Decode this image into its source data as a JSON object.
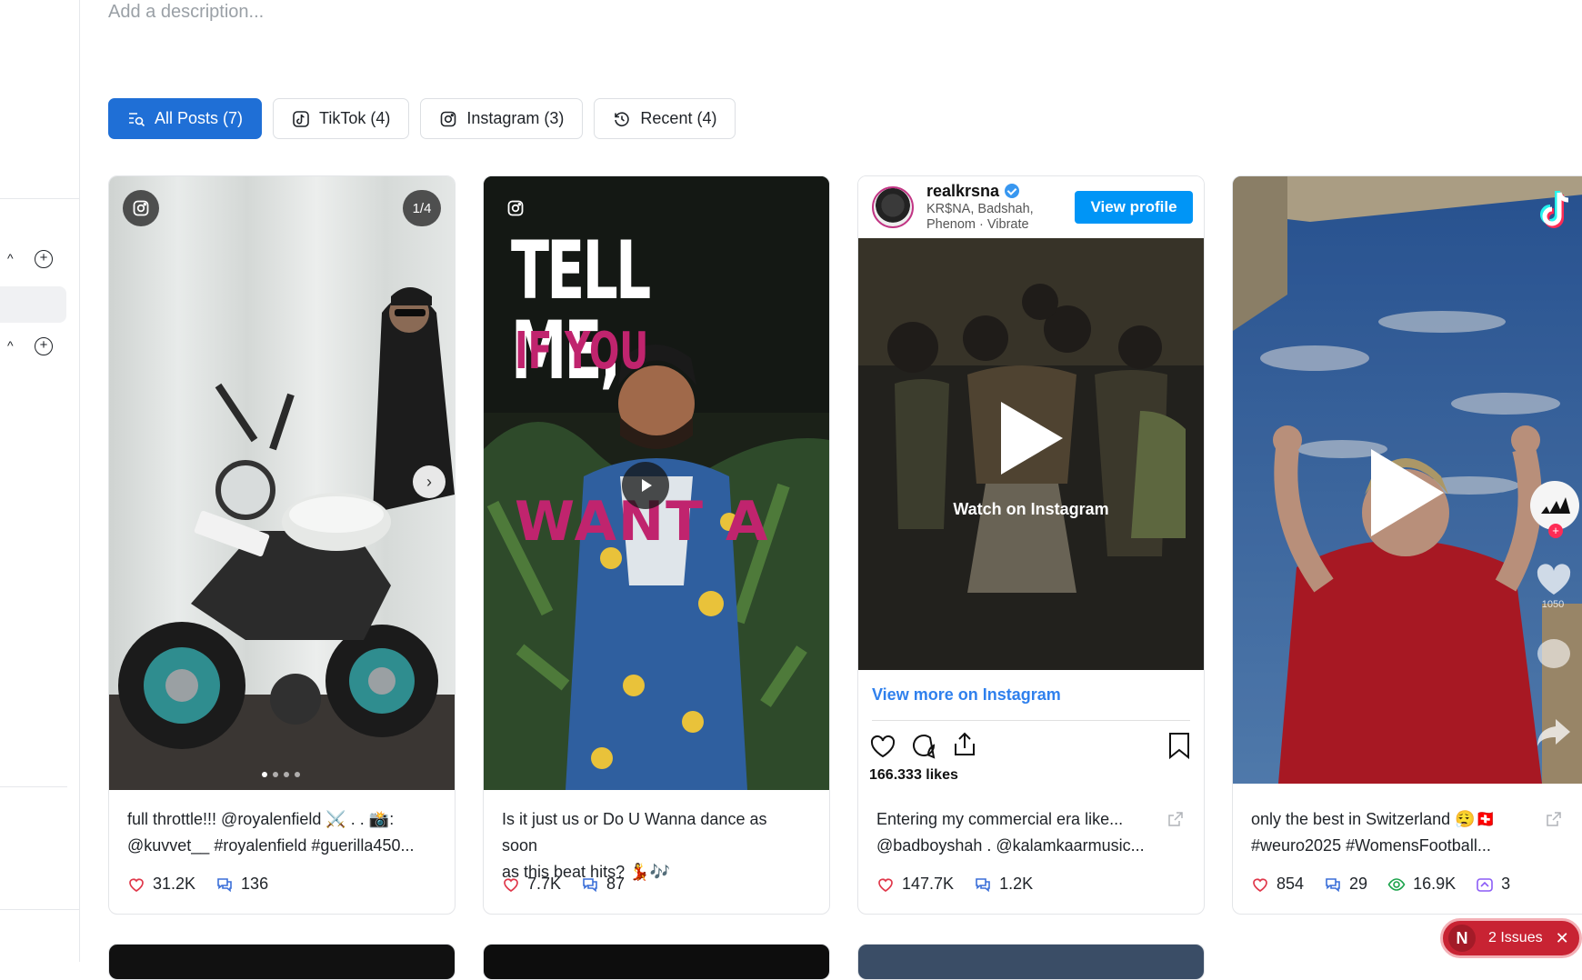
{
  "description_placeholder": "Add a description...",
  "tabs": [
    {
      "label": "All Posts (7)",
      "icon": "search-list-icon",
      "active": true
    },
    {
      "label": "TikTok (4)",
      "icon": "tiktok-icon",
      "active": false
    },
    {
      "label": "Instagram (3)",
      "icon": "instagram-icon",
      "active": false
    },
    {
      "label": "Recent (4)",
      "icon": "history-icon",
      "active": false
    }
  ],
  "cards": [
    {
      "platform": "instagram",
      "counter": "1/4",
      "caption_line1": "full throttle!!! @royalenfield ⚔️ . . 📸:",
      "caption_line2": "@kuvvet__ #royalenfield #guerilla450...",
      "likes": "31.2K",
      "comments": "136"
    },
    {
      "platform": "instagram",
      "overlay_line1": "TELL ME,",
      "overlay_line2": "IF YOU",
      "overlay_line3": "WANT A",
      "caption_line1": "Is it just us or Do U Wanna dance as soon",
      "caption_line2": "as this beat hits? 💃🎶",
      "likes": "7.7K",
      "comments": "87"
    },
    {
      "platform": "instagram-embed",
      "handle": "realkrsna",
      "subtitle": "KR$NA, Badshah, Phenom · Vibrate",
      "view_profile": "View profile",
      "watch_label": "Watch on Instagram",
      "view_more": "View more on Instagram",
      "likes_text": "166,333 likes",
      "caption_line1": "Entering my commercial era like...",
      "caption_line2": "@badboyshah . @kalamkaarmusic...",
      "likes": "147.7K",
      "comments": "1.2K"
    },
    {
      "platform": "tiktok",
      "side_count": "1050",
      "caption_line1": "only the best in Switzerland 😮‍💨🇨🇭",
      "caption_line2": "#weuro2025 #WomensFootball...",
      "likes": "854",
      "comments": "29",
      "views": "16.9K",
      "shares": "3"
    }
  ],
  "issues_badge": {
    "initial": "N",
    "label": "2 Issues"
  },
  "colors": {
    "primary": "#1f6fd6",
    "like": "#e0384b",
    "comment": "#3b6fd8",
    "views": "#1aa34a",
    "shares": "#8b5cf6"
  }
}
